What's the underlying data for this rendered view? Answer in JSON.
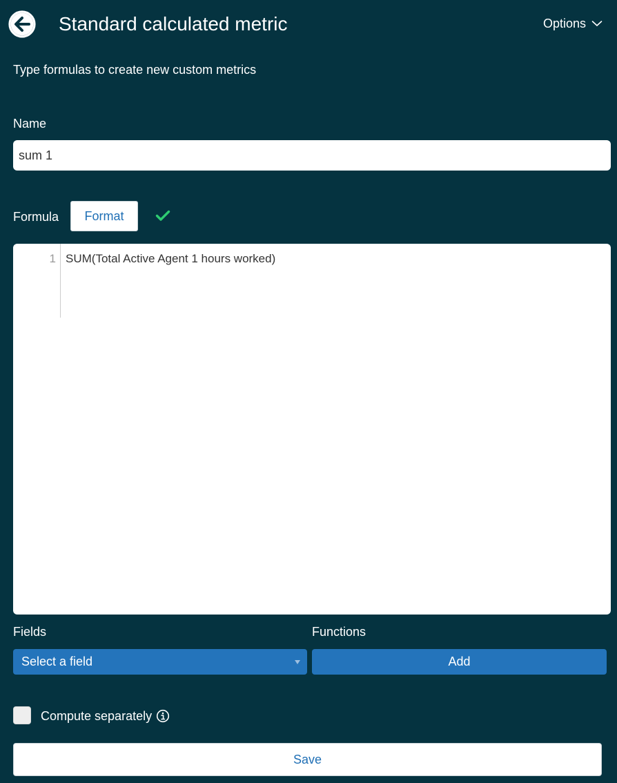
{
  "header": {
    "title": "Standard calculated metric",
    "options_label": "Options",
    "back_icon": "arrow-left-circle-icon",
    "options_icon": "chevron-down-icon"
  },
  "subtitle": "Type formulas to create new custom metrics",
  "name": {
    "label": "Name",
    "value": "sum 1"
  },
  "formula": {
    "label": "Formula",
    "format_label": "Format",
    "status_icon": "checkmark-icon",
    "status_color": "#2ecc71",
    "line_number": "1",
    "code": "SUM(Total Active Agent 1 hours worked)"
  },
  "fields": {
    "label": "Fields",
    "select_value": "Select a field"
  },
  "functions": {
    "label": "Functions",
    "add_label": "Add"
  },
  "compute": {
    "label": "Compute separately",
    "checked": false,
    "info_icon": "info-circle-icon"
  },
  "save_label": "Save",
  "colors": {
    "background": "#053340",
    "accent": "#2474bb",
    "link": "#1f6fb5"
  }
}
